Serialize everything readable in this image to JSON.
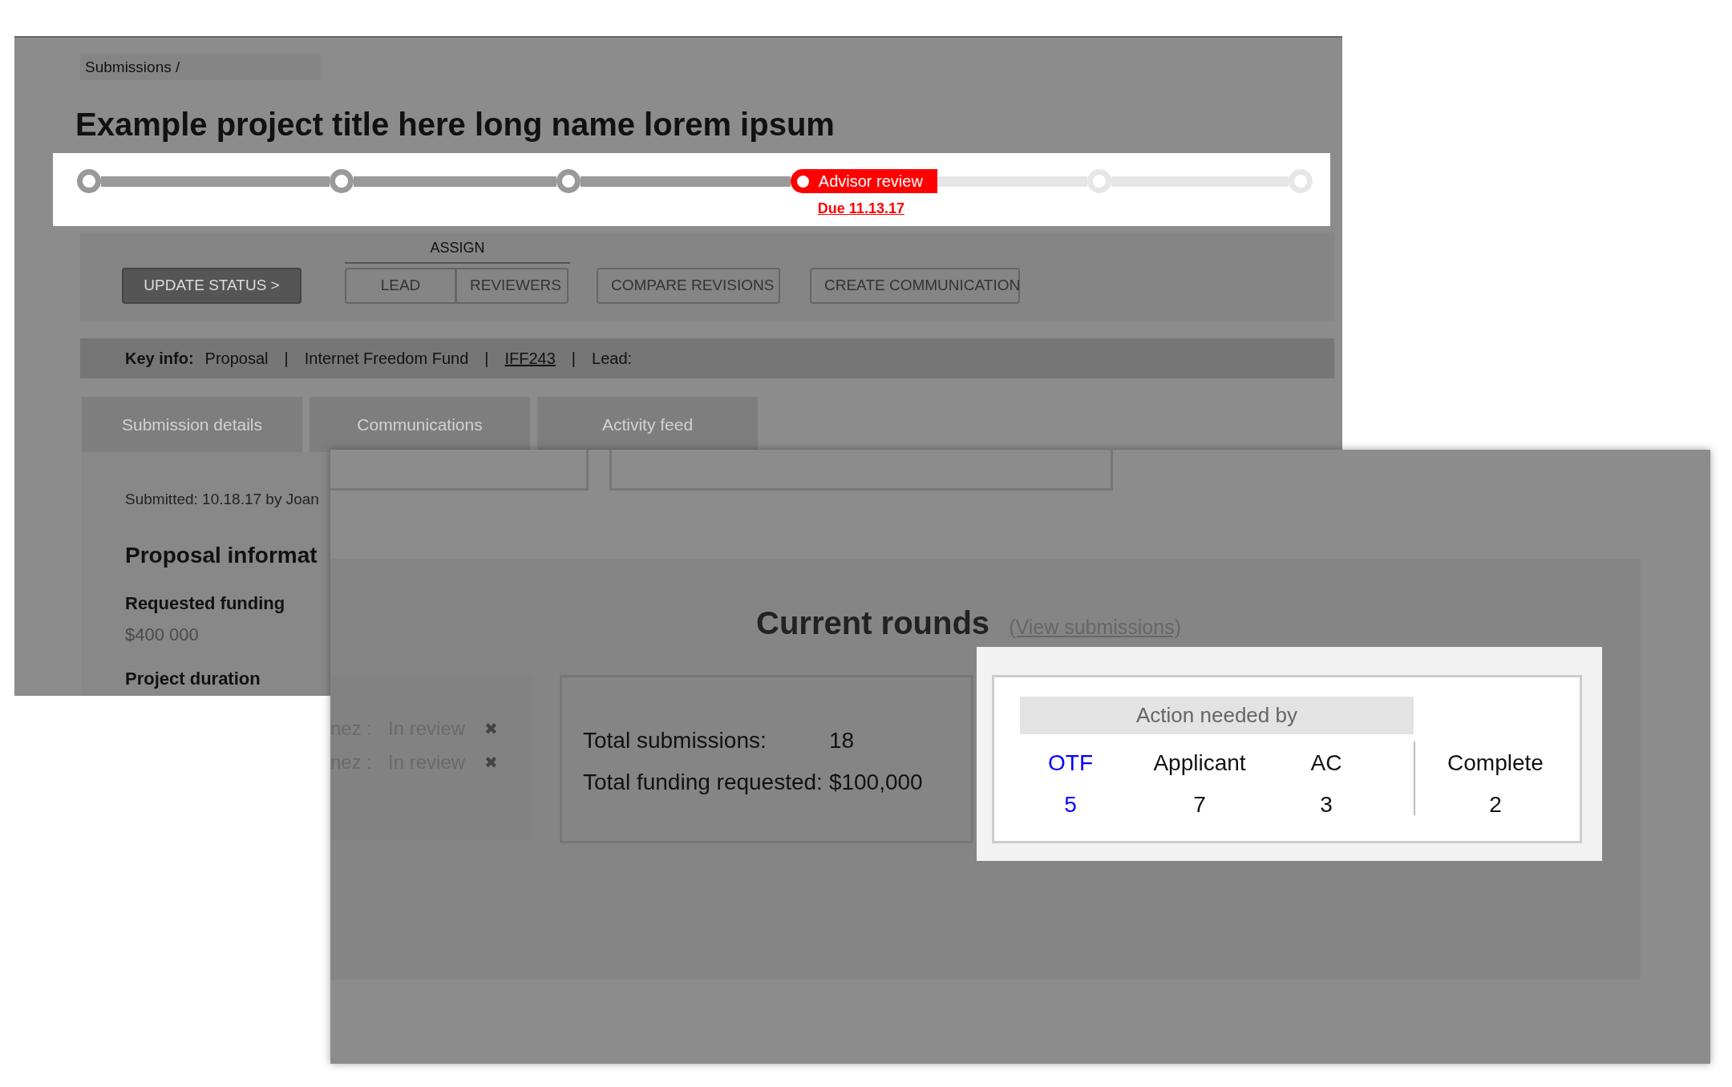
{
  "back_window": {
    "breadcrumb": "Submissions /",
    "title": "Example project title here long name lorem ipsum",
    "stepper": [
      {
        "kind": "done"
      },
      {
        "kind": "done"
      },
      {
        "kind": "done"
      },
      {
        "kind": "current",
        "label": "Advisor review",
        "due": "Due 11.13.17"
      },
      {
        "kind": "todo"
      },
      {
        "kind": "todo"
      }
    ],
    "actions": {
      "update_button": "UPDATE STATUS >",
      "assign_label": "ASSIGN",
      "assign_buttons": [
        "LEAD",
        "REVIEWERS"
      ],
      "buttons": [
        "COMPARE REVISIONS",
        "CREATE COMMUNICATION"
      ]
    },
    "key_info": {
      "label": "Key info:",
      "items": [
        {
          "kind": "text",
          "text": "Proposal"
        },
        {
          "kind": "sep",
          "text": "|"
        },
        {
          "kind": "text",
          "text": "Internet Freedom Fund"
        },
        {
          "kind": "sep",
          "text": "|"
        },
        {
          "kind": "link",
          "text": "IFF243"
        },
        {
          "kind": "sep",
          "text": "|"
        },
        {
          "kind": "text",
          "text": "Lead:"
        }
      ]
    },
    "tabs": [
      {
        "label": "Submission details",
        "selected": false
      },
      {
        "label": "Communications",
        "selected": false
      },
      {
        "label": "Activity feed",
        "selected": false
      }
    ],
    "details": {
      "submitted": "Submitted: 10.18.17 by Joan",
      "heading": "Proposal informat",
      "fields": [
        {
          "label": "Requested funding",
          "value": "$400 000"
        },
        {
          "label": "Project duration"
        }
      ]
    }
  },
  "front_window": {
    "heading": "Current rounds",
    "link": "(View submissions)",
    "reviewers": [
      {
        "name": "nez :",
        "status": "In review",
        "remove": "✖"
      },
      {
        "name": "nez :",
        "status": "In review",
        "remove": "✖"
      }
    ],
    "totals": [
      {
        "label": "Total submissions:",
        "value": "18"
      },
      {
        "label": "Total funding requested:",
        "value": "$100,000"
      }
    ],
    "action_needed": {
      "title": "Action needed by",
      "groups": [
        {
          "label": "OTF",
          "value": "5",
          "color": "#0000ff"
        },
        {
          "label": "Applicant",
          "value": "7",
          "color": "#111111"
        },
        {
          "label": "AC",
          "value": "3",
          "color": "#111111"
        }
      ],
      "complete": {
        "label": "Complete",
        "value": "2"
      }
    }
  }
}
